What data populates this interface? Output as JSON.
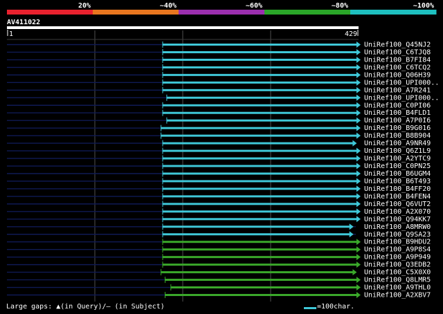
{
  "chart_data": {
    "type": "bar",
    "identity_scale": {
      "labels": [
        "20%",
        "~40%",
        "~60%",
        "~80%",
        "~100%"
      ],
      "colors": [
        "#e8212e",
        "#e8761f",
        "#9b2fae",
        "#2aa528",
        "#1ebfbf"
      ]
    },
    "query": {
      "name": "AV411022",
      "start_label": "1",
      "end_label": "429",
      "length": 429
    },
    "hits": [
      {
        "name": "UniRef100_Q45NJ2",
        "start": 190,
        "end": 440,
        "color": "#3fc8d8"
      },
      {
        "name": "UniRef100_C6TJQ8",
        "start": 190,
        "end": 440,
        "color": "#3fc8d8"
      },
      {
        "name": "UniRef100_B7FI84",
        "start": 190,
        "end": 440,
        "color": "#3fc8d8"
      },
      {
        "name": "UniRef100_C6TCQ2",
        "start": 190,
        "end": 432,
        "color": "#3fc8d8"
      },
      {
        "name": "UniRef100_Q06H39",
        "start": 190,
        "end": 440,
        "color": "#3fc8d8"
      },
      {
        "name": "UniRef100_UPI000..",
        "start": 190,
        "end": 432,
        "color": "#3fc8d8"
      },
      {
        "name": "UniRef100_A7R241",
        "start": 190,
        "end": 432,
        "color": "#3fc8d8"
      },
      {
        "name": "UniRef100_UPI000..",
        "start": 195,
        "end": 432,
        "color": "#3fc8d8"
      },
      {
        "name": "UniRef100_C0PI06",
        "start": 190,
        "end": 436,
        "color": "#3fc8d8"
      },
      {
        "name": "UniRef100_B4FLD1",
        "start": 190,
        "end": 436,
        "color": "#3fc8d8"
      },
      {
        "name": "UniRef100_A7P0I6",
        "start": 195,
        "end": 436,
        "color": "#3fc8d8"
      },
      {
        "name": "UniRef100_B9G016",
        "start": 188,
        "end": 436,
        "color": "#3fc8d8"
      },
      {
        "name": "UniRef100_B8B904",
        "start": 188,
        "end": 436,
        "color": "#3fc8d8"
      },
      {
        "name": "UniRef100_A9NR49",
        "start": 190,
        "end": 426,
        "color": "#3fc8d8"
      },
      {
        "name": "UniRef100_Q6Z1L9",
        "start": 190,
        "end": 436,
        "color": "#3fc8d8"
      },
      {
        "name": "UniRef100_A2YTC9",
        "start": 190,
        "end": 436,
        "color": "#3fc8d8"
      },
      {
        "name": "UniRef100_C0PN25",
        "start": 190,
        "end": 436,
        "color": "#3fc8d8"
      },
      {
        "name": "UniRef100_B6UGM4",
        "start": 190,
        "end": 436,
        "color": "#3fc8d8"
      },
      {
        "name": "UniRef100_B6T493",
        "start": 190,
        "end": 436,
        "color": "#3fc8d8"
      },
      {
        "name": "UniRef100_B4FF20",
        "start": 190,
        "end": 436,
        "color": "#3fc8d8"
      },
      {
        "name": "UniRef100_B4FEN4",
        "start": 190,
        "end": 436,
        "color": "#3fc8d8"
      },
      {
        "name": "UniRef100_Q6VUT2",
        "start": 190,
        "end": 436,
        "color": "#3fc8d8"
      },
      {
        "name": "UniRef100_A2X070",
        "start": 190,
        "end": 436,
        "color": "#3fc8d8"
      },
      {
        "name": "UniRef100_Q94KK7",
        "start": 190,
        "end": 432,
        "color": "#3fc8d8"
      },
      {
        "name": "UniRef100_A8MRW0",
        "start": 190,
        "end": 422,
        "color": "#3fc8d8"
      },
      {
        "name": "UniRef100_Q9SA23",
        "start": 190,
        "end": 422,
        "color": "#3fc8d8"
      },
      {
        "name": "UniRef100_B9HDU2",
        "start": 190,
        "end": 432,
        "color": "#3aa82a"
      },
      {
        "name": "UniRef100_A9P8S4",
        "start": 190,
        "end": 432,
        "color": "#3aa82a"
      },
      {
        "name": "UniRef100_A9P949",
        "start": 190,
        "end": 432,
        "color": "#3aa82a"
      },
      {
        "name": "UniRef100_Q3EDB2",
        "start": 190,
        "end": 436,
        "color": "#3aa82a"
      },
      {
        "name": "UniRef100_C5X0X0",
        "start": 188,
        "end": 426,
        "color": "#3aa82a"
      },
      {
        "name": "UniRef100_Q8LMR5",
        "start": 193,
        "end": 432,
        "color": "#3aa82a"
      },
      {
        "name": "UniRef100_A9THL0",
        "start": 200,
        "end": 436,
        "color": "#3aa82a"
      },
      {
        "name": "UniRef100_A2XBV7",
        "start": 193,
        "end": 436,
        "color": "#3aa82a"
      }
    ]
  },
  "footer": {
    "gaps_text": "Large gaps: ▲(in Query)/— (in Subject)",
    "scale_text": "=100char."
  }
}
